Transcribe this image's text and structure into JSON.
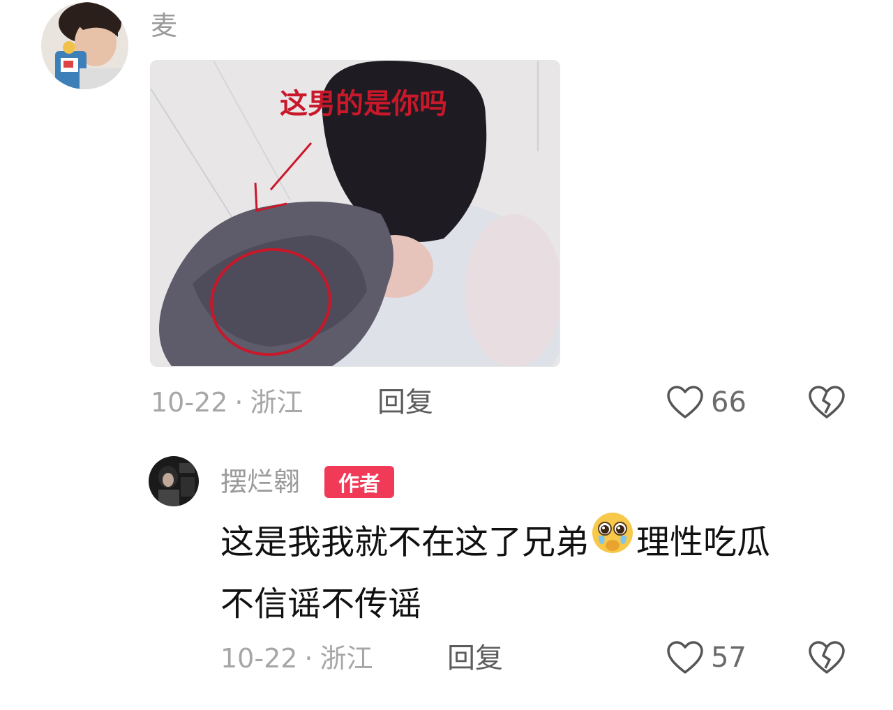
{
  "comment1": {
    "username": "麦",
    "image_caption": "这男的是你吗",
    "date": "10-22",
    "separator": "·",
    "location": "浙江",
    "reply_label": "回复",
    "likes": "66"
  },
  "comment2": {
    "username": "摆烂翱",
    "author_badge": "作者",
    "text_part1": "这是我我就不在这了兄弟",
    "emoji": "pleading-crying-emoji",
    "text_part2": "理性吃瓜",
    "text_part3": "不信谣不传谣",
    "date": "10-22",
    "separator": "·",
    "location": "浙江",
    "reply_label": "回复",
    "likes": "57"
  },
  "colors": {
    "badge": "#f03a57",
    "annotation_red": "#c8182a",
    "meta_gray": "#a6a6a6"
  }
}
